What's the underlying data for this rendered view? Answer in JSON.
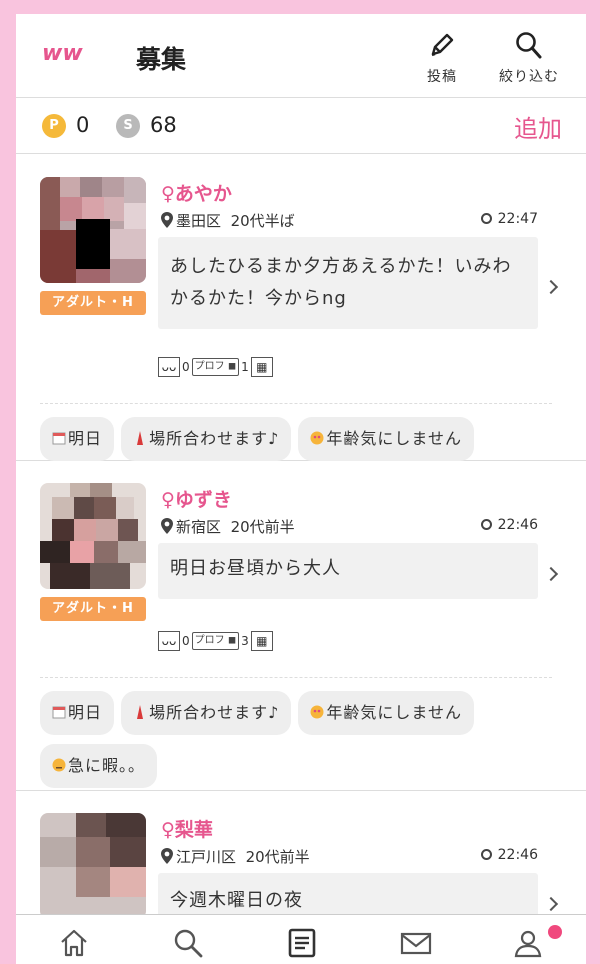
{
  "header": {
    "logo_text": "ww",
    "title": "募集",
    "post_label": "投稿",
    "filter_label": "絞り込む"
  },
  "points": {
    "p_value": "0",
    "s_value": "68",
    "add_label": "追加"
  },
  "posts": [
    {
      "name": "♀あやか",
      "area": "墨田区",
      "age": "20代半ば",
      "time": "22:47",
      "message": "あしたひるまか夕方あえるかた！いみわかるかた！今からng",
      "badge": "アダルト・H",
      "views": "0",
      "prof_label": "プロフ",
      "photos": "1",
      "tags": [
        "明日",
        "場所合わせます♪",
        "年齢気にしません"
      ]
    },
    {
      "name": "♀ゆずき",
      "area": "新宿区",
      "age": "20代前半",
      "time": "22:46",
      "message": "明日お昼頃から大人",
      "badge": "アダルト・H",
      "views": "0",
      "prof_label": "プロフ",
      "photos": "3",
      "tags": [
        "明日",
        "場所合わせます♪",
        "年齢気にしません",
        "急に暇。。"
      ]
    },
    {
      "name": "♀梨華",
      "area": "江戸川区",
      "age": "20代前半",
      "time": "22:46",
      "message": "今週木曜日の夜"
    }
  ],
  "colors": {
    "accent": "#e6568e",
    "badge": "#f6a056",
    "frame": "#f9c4de"
  },
  "icons": {
    "tabs": [
      "home-icon",
      "search-icon",
      "board-icon",
      "mail-icon",
      "profile-icon"
    ]
  }
}
